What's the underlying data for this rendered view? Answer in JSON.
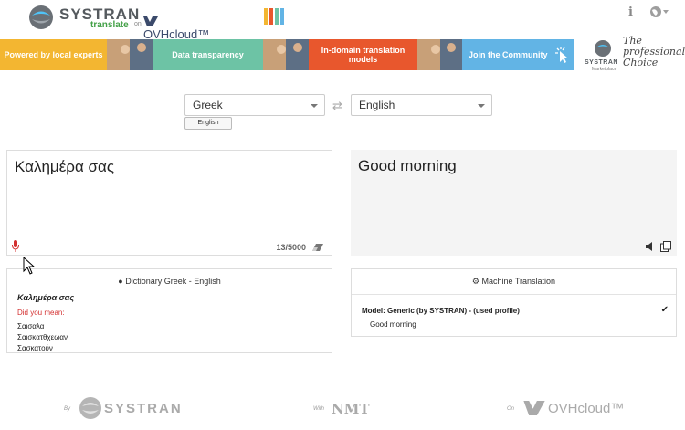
{
  "header": {
    "brand": "SYSTRAN",
    "product": "translate",
    "on_label": "on",
    "partner": "OVHcloud™",
    "icons": {
      "info": "info-icon",
      "language": "globe-icon"
    }
  },
  "banner": {
    "tiles": [
      {
        "label": "Powered by local experts",
        "color": "#f3b631"
      },
      {
        "label": "Data transparency",
        "color": "#6dc3a5"
      },
      {
        "label": "In-domain translation models",
        "color": "#e8572d"
      },
      {
        "label": "Join the Community",
        "color": "#62b4e5"
      }
    ],
    "marketplace": {
      "brand": "SYSTRAN",
      "sub": "Marketplace",
      "tagline": "The professional Choice"
    }
  },
  "translator": {
    "source_lang": "Greek",
    "target_lang": "English",
    "detected_lang": "English",
    "source_text": "Καλημέρα σας",
    "target_text": "Good morning",
    "char_count": "13/5000"
  },
  "dictionary": {
    "title": "Dictionary Greek - English",
    "word": "Καλημέρα σας",
    "did_you_mean": "Did you mean:",
    "suggestions": [
      "Σαισαλα",
      "Σαισκατθχεωαν",
      "Σασκατούν"
    ]
  },
  "machine_translation": {
    "title": "Machine Translation",
    "model": "Model: Generic (by SYSTRAN) - (used profile)",
    "result": "Good morning"
  },
  "footer": {
    "by_label": "By",
    "by_brand": "SYSTRAN",
    "with_label": "With",
    "with_brand": "NMT",
    "on_label": "On",
    "on_brand": "OVHcloud™"
  },
  "colors": {
    "stripe_1": "#f3b631",
    "stripe_2": "#e8572d",
    "stripe_3": "#6dc3a5",
    "stripe_4": "#62b4e5",
    "mic": "#d32f2f"
  }
}
